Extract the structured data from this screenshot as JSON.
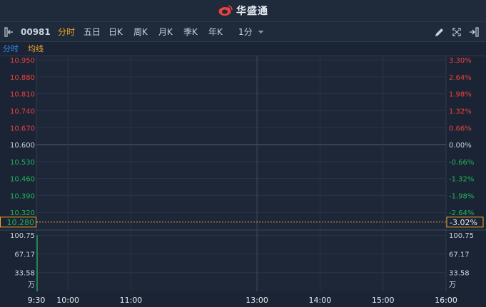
{
  "app": {
    "title": "华盛通"
  },
  "toolbar": {
    "code": "00981",
    "tabs": [
      "分时",
      "五日",
      "日K",
      "周K",
      "月K",
      "季K",
      "年K"
    ],
    "active_tab": "分时",
    "interval": "1分"
  },
  "subbar": {
    "left": "分时",
    "right": "均线"
  },
  "colors": {
    "up": "#e8423f",
    "down": "#21b35a",
    "neutral": "#c9d2de",
    "accent": "#f0a52a",
    "price_line": "#2f8fff"
  },
  "icons": [
    "collapse-left-icon",
    "pencil-icon",
    "fullscreen-icon",
    "exit-icon",
    "dropdown-arrow-icon"
  ],
  "chart_data": {
    "type": "line",
    "price_axis": {
      "ticks": [
        "10.950",
        "10.880",
        "10.810",
        "10.740",
        "10.670",
        "10.600",
        "10.530",
        "10.460",
        "10.390",
        "10.320"
      ],
      "pct_ticks": [
        "3.30%",
        "2.64%",
        "1.98%",
        "1.32%",
        "0.66%",
        "0.00%",
        "-0.66%",
        "-1.32%",
        "-1.98%",
        "-2.64%"
      ],
      "prev_close": 10.6,
      "ylim": [
        10.25,
        10.965
      ]
    },
    "current": {
      "price": "10.280",
      "change_pct": "-3.02%"
    },
    "volume_axis": {
      "ticks": [
        "100.75",
        "67.17",
        "33.58"
      ],
      "unit": "万",
      "ylim": [
        0,
        110
      ]
    },
    "time_axis": [
      "9:30",
      "10:00",
      "11:00",
      "13:00",
      "14:00",
      "15:00",
      "16:00"
    ],
    "series": [
      {
        "x": [
          "9:30"
        ],
        "values": [
          10.28
        ]
      }
    ],
    "volume": [
      {
        "x": "9:30",
        "value": 100.75
      }
    ]
  }
}
